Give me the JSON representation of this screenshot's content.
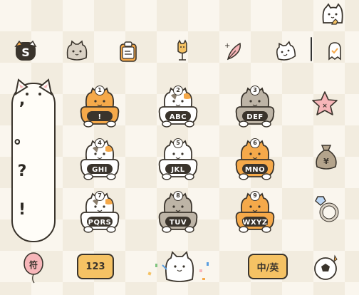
{
  "punctuation": [
    ",",
    "。",
    "?",
    "!"
  ],
  "keys": [
    {
      "label": "!",
      "num": "1",
      "color": "orange"
    },
    {
      "label": "ABC",
      "num": "2",
      "color": "calico"
    },
    {
      "label": "DEF",
      "num": "3",
      "color": "gray"
    },
    {
      "label": "GHI",
      "num": "4",
      "color": "calico"
    },
    {
      "label": "JKL",
      "num": "5",
      "color": "white"
    },
    {
      "label": "MNO",
      "num": "6",
      "color": "orange"
    },
    {
      "label": "PQRS",
      "num": "7",
      "color": "calico"
    },
    {
      "label": "TUV",
      "num": "8",
      "color": "gray"
    },
    {
      "label": "WXYZ",
      "num": "9",
      "color": "orange"
    }
  ],
  "bottom": {
    "symbols_label": "符",
    "numbers_label": "123",
    "lang_label": "中/英"
  },
  "colors": {
    "orange": "#f5a94a",
    "gray": "#bdb4a6",
    "white": "#ffffff",
    "outline": "#3a342c",
    "pink": "#f7b6b9",
    "yellow": "#f5c264"
  },
  "icons": {
    "toolbar": [
      "s-logo-icon",
      "cat-face-icon",
      "clipboard-icon",
      "microphone-icon",
      "feather-edit-icon",
      "cat-emoji-icon",
      "ghost-hide-icon"
    ],
    "side": [
      "star-icon",
      "money-bag-icon",
      "diamond-ring-icon",
      "soccer-ball-icon"
    ]
  }
}
